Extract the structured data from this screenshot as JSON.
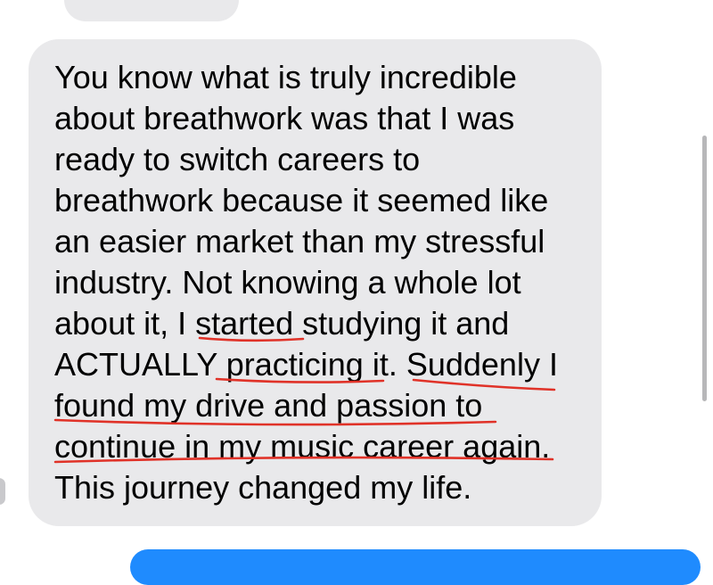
{
  "conversation": {
    "received_message": {
      "lines": [
        "You know what is truly incredible",
        "about breathwork was that I was",
        "ready to switch careers to",
        "breathwork because it seemed like",
        "an easier market than my stressful",
        "industry. Not knowing a whole lot",
        "about it, I started studying it and",
        "ACTUALLY practicing it. Suddenly I",
        "found my drive and passion to",
        "continue in my music career again.",
        "This journey changed my life."
      ],
      "underlined_phrases": [
        "started",
        "practicing it.",
        "Suddenly I",
        "found my drive and passion to",
        "continue in my music career again"
      ],
      "underline_color": "#e03228",
      "bubble_color": "#e9e9eb"
    },
    "sent_bubble_color": "#1f8bfe"
  }
}
